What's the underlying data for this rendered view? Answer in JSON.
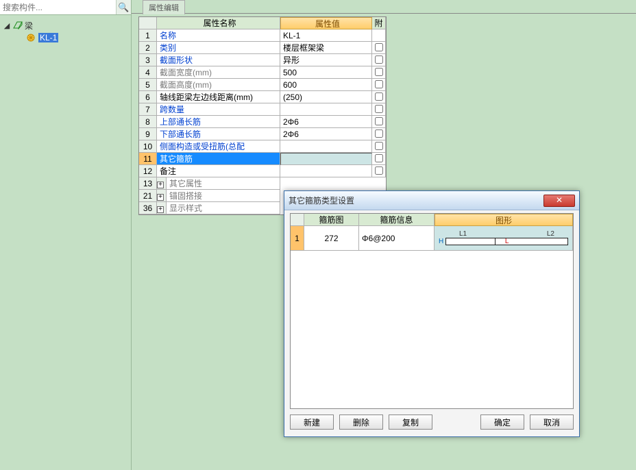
{
  "search": {
    "placeholder": "搜索构件..."
  },
  "tree": {
    "root_label": "梁",
    "leaf_label": "KL-1"
  },
  "tab": {
    "label": "属性编辑"
  },
  "grid": {
    "head_name": "属性名称",
    "head_value": "属性值",
    "head_add": "附",
    "rows": [
      {
        "n": "1",
        "name": "名称",
        "cls": "link",
        "val": "KL-1",
        "chk": false
      },
      {
        "n": "2",
        "name": "类别",
        "cls": "link",
        "val": "楼层框架梁",
        "chk": true
      },
      {
        "n": "3",
        "name": "截面形状",
        "cls": "link",
        "val": "异形",
        "chk": true
      },
      {
        "n": "4",
        "name": "截面宽度(mm)",
        "cls": "gray",
        "val": "500",
        "chk": true
      },
      {
        "n": "5",
        "name": "截面高度(mm)",
        "cls": "gray",
        "val": "600",
        "chk": true
      },
      {
        "n": "6",
        "name": "轴线距梁左边线距离(mm)",
        "cls": "",
        "val": "(250)",
        "chk": true
      },
      {
        "n": "7",
        "name": "跨数量",
        "cls": "link",
        "val": "",
        "chk": true
      },
      {
        "n": "8",
        "name": "上部通长筋",
        "cls": "link",
        "val": "2Φ6",
        "chk": true
      },
      {
        "n": "9",
        "name": "下部通长筋",
        "cls": "link",
        "val": "2Φ6",
        "chk": true
      },
      {
        "n": "10",
        "name": "侧面构造或受扭筋(总配",
        "cls": "link",
        "val": "",
        "chk": true
      },
      {
        "n": "11",
        "name": "其它箍筋",
        "cls": "sel",
        "val": "",
        "chk": true,
        "edit": true
      },
      {
        "n": "12",
        "name": "备注",
        "cls": "",
        "val": "",
        "chk": true
      },
      {
        "n": "13",
        "name": "其它属性",
        "cls": "gray",
        "plus": true
      },
      {
        "n": "21",
        "name": "锚固搭接",
        "cls": "gray",
        "plus": true
      },
      {
        "n": "36",
        "name": "显示样式",
        "cls": "gray",
        "plus": true
      }
    ]
  },
  "dialog": {
    "title": "其它箍筋类型设置",
    "head_img": "箍筋图",
    "head_info": "箍筋信息",
    "head_shape": "图形",
    "row": {
      "n": "1",
      "img": "272",
      "info": "Φ6@200",
      "L1": "L1",
      "L2": "L2",
      "H": "H",
      "L": "L"
    },
    "buttons": {
      "new": "新建",
      "del": "删除",
      "copy": "复制",
      "ok": "确定",
      "cancel": "取消"
    }
  }
}
